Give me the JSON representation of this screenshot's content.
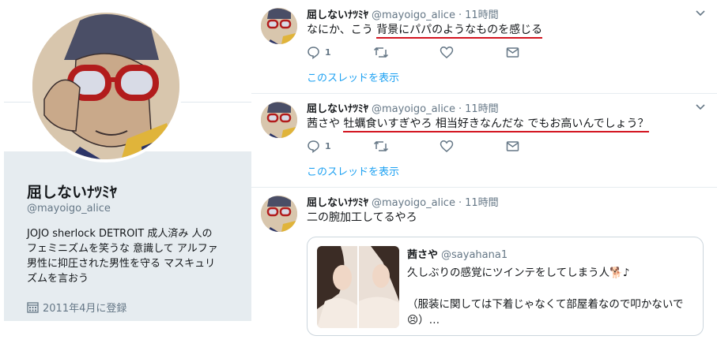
{
  "profile": {
    "name": "屈しないﾅﾂﾐﾔ",
    "handle": "@mayoigo_alice",
    "bio_lines": [
      "JOJO sherlock DETROIT 成人済み 人の",
      "フェミニズムを笑うな 意識して アルファ",
      "男性に抑圧された男性を守る マスキュリ",
      "ズムを言おう"
    ],
    "joined": "2011年4月に登録",
    "joined_icon": "calendar-icon"
  },
  "tweets": [
    {
      "name": "屈しないﾅﾂﾐﾔ",
      "handle": "@mayoigo_alice",
      "dot": "·",
      "time": "11時間",
      "text_plain": "なにか、こう",
      "text_underlined": "背景にパパのようなものを感じる",
      "reply_count": "1",
      "thread_link": "このスレッドを表示"
    },
    {
      "name": "屈しないﾅﾂﾐﾔ",
      "handle": "@mayoigo_alice",
      "dot": "·",
      "time": "11時間",
      "text_plain": "茜さや",
      "text_underlined": "牡蠣食いすぎやろ 相当好きなんだな でもお高いんでしょう？",
      "reply_count": "1",
      "thread_link": "このスレッドを表示"
    },
    {
      "name": "屈しないﾅﾂﾐﾔ",
      "handle": "@mayoigo_alice",
      "dot": "·",
      "time": "11時間",
      "text_plain": "二の腕加工してるやろ",
      "quote": {
        "name": "茜さや",
        "handle": "@sayahana1",
        "line1": "久しぶりの感覚にツインテをしてしまう人🐕♪",
        "line2": "（服装に関しては下着じゃなくて部屋着なので叩かないで",
        "line3": "😣）…"
      }
    }
  ],
  "colors": {
    "link_blue": "#1da1f2",
    "underline_red": "#d3141f",
    "muted_gray": "#657786",
    "card_bg": "#e6ecf0"
  }
}
